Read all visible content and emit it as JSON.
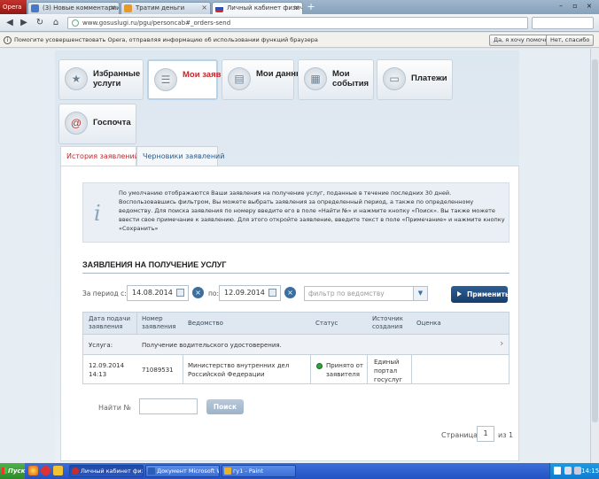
{
  "browser": {
    "menu_label": "Opera",
    "tabs": [
      {
        "title": "(3) Новые комментарии",
        "color": "#4a78c8"
      },
      {
        "title": "Тратим деньги",
        "color": "#e59a2b"
      },
      {
        "title": "Личный кабинет физическо...",
        "color": "#cc2b2b"
      }
    ],
    "url": "www.gosuslugi.ru/pgu/personcab#_orders-send",
    "notification": {
      "text": "Помогите усовершенствовать Opera, отправляя информацию об использовании функций браузера",
      "accept": "Да, я хочу помочь",
      "decline": "Нет, спасибо"
    }
  },
  "nav": [
    {
      "label": "Избранные услуги",
      "icon": "favorites-icon",
      "glyph": "★"
    },
    {
      "label": "Мои заявки",
      "icon": "list-icon",
      "glyph": "☰"
    },
    {
      "label": "Мои данные",
      "icon": "user-data-icon",
      "glyph": "▤"
    },
    {
      "label": "Мои события",
      "icon": "calendar-icon",
      "glyph": "▦"
    },
    {
      "label": "Платежи",
      "icon": "wallet-icon",
      "glyph": "▭"
    },
    {
      "label": "Госпочта",
      "icon": "mail-icon",
      "glyph": "@"
    }
  ],
  "tabs": {
    "history": "История заявлений",
    "drafts": "Черновики заявлений"
  },
  "info": {
    "text": "По умолчанию отображаются Ваши заявления на получение услуг, поданные в течение последних 30 дней. Воспользовавшись фильтром, Вы можете выбрать заявления за определенный период, а также по определенному ведомству. Для поиска заявления по номеру введите его в поле «Найти №» и нажмите кнопку «Поиск». Вы также можете ввести свое примечание к заявлению. Для этого откройте заявление, введите текст в поле «Примечание» и нажмите кнопку «Сохранить»"
  },
  "section_title": "ЗАЯВЛЕНИЯ НА ПОЛУЧЕНИЕ УСЛУГ",
  "filter": {
    "period_label": "За период с:",
    "date_from": "14.08.2014",
    "to_label": "по:",
    "date_to": "12.09.2014",
    "dept_placeholder": "фильтр по ведомству",
    "apply": "Применить"
  },
  "table": {
    "headers": [
      "Дата подачи заявления",
      "Номер заявления",
      "Ведомство",
      "Статус",
      "Источник создания",
      "Оценка"
    ],
    "service_label": "Услуга:",
    "service_value": "Получение водительского удостоверения.",
    "row": {
      "date": "12.09.2014",
      "time": "14:13",
      "number": "71089531",
      "dept": "Министерство внутренних дел Российской Федерации",
      "status": "Принято от заявителя",
      "source": "Единый портал госуслуг",
      "rating": ""
    }
  },
  "search": {
    "label": "Найти №",
    "value": "",
    "button": "Поиск"
  },
  "pager": {
    "label": "Страница",
    "page": "1",
    "of": "из 1"
  },
  "taskbar": {
    "start": "Пуск",
    "items": [
      {
        "title": "Личный кабинет физ...",
        "color": "#cc2b2b"
      },
      {
        "title": "Документ Microsoft Wor...",
        "color": "#2b5fb5"
      },
      {
        "title": "гу1 - Paint",
        "color": "#e8b02b"
      }
    ],
    "clock": "14:15"
  }
}
